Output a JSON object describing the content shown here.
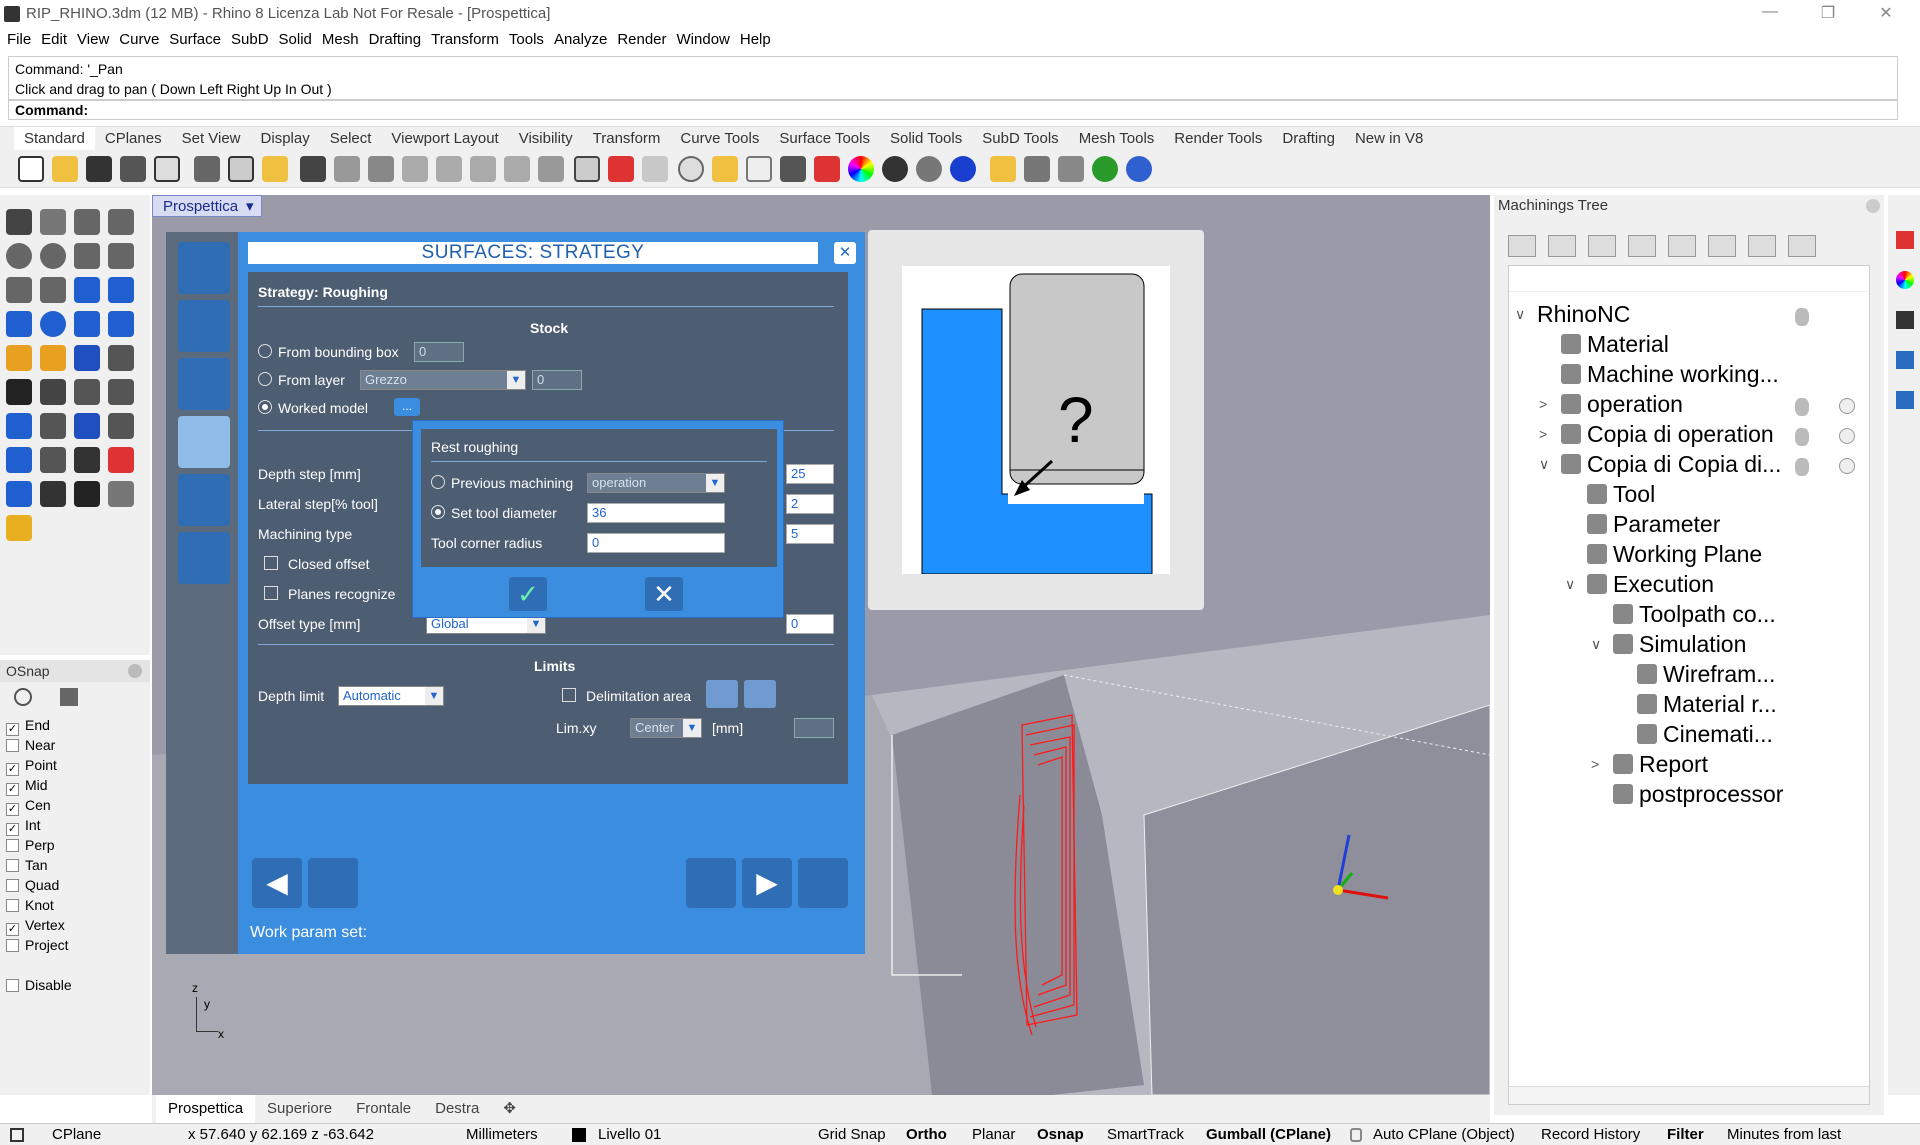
{
  "window": {
    "title": "RIP_RHINO.3dm (12 MB) - Rhino 8 Licenza Lab Not For Resale - [Prospettica]",
    "min": "—",
    "restore": "❐",
    "close": "✕"
  },
  "menu": [
    "File",
    "Edit",
    "View",
    "Curve",
    "Surface",
    "SubD",
    "Solid",
    "Mesh",
    "Drafting",
    "Transform",
    "Tools",
    "Analyze",
    "Render",
    "Window",
    "Help"
  ],
  "command": {
    "history1": "Command: '_Pan",
    "history2": "Click and drag to pan ( Down  Left  Right  Up  In  Out )",
    "prompt": "Command:"
  },
  "toolbar_tabs": [
    "Standard",
    "CPlanes",
    "Set View",
    "Display",
    "Select",
    "Viewport Layout",
    "Visibility",
    "Transform",
    "Curve Tools",
    "Surface Tools",
    "Solid Tools",
    "SubD Tools",
    "Mesh Tools",
    "Render Tools",
    "Drafting",
    "New in V8"
  ],
  "osnap": {
    "title": "OSnap",
    "items": [
      {
        "label": "End",
        "checked": true
      },
      {
        "label": "Near",
        "checked": false
      },
      {
        "label": "Point",
        "checked": true
      },
      {
        "label": "Mid",
        "checked": true
      },
      {
        "label": "Cen",
        "checked": true
      },
      {
        "label": "Int",
        "checked": true
      },
      {
        "label": "Perp",
        "checked": false
      },
      {
        "label": "Tan",
        "checked": false
      },
      {
        "label": "Quad",
        "checked": false
      },
      {
        "label": "Knot",
        "checked": false
      },
      {
        "label": "Vertex",
        "checked": true
      },
      {
        "label": "Project",
        "checked": false
      }
    ],
    "disable": "Disable",
    "check_mark": "✓"
  },
  "viewport": {
    "label": "Prospettica",
    "tabs": [
      "Prospettica",
      "Superiore",
      "Frontale",
      "Destra"
    ],
    "add": "✥",
    "axis_z": "z",
    "axis_y": "y",
    "axis_x": "x"
  },
  "dialog": {
    "title": "SURFACES:  STRATEGY",
    "close": "✕",
    "strategy": "Strategy: Roughing",
    "stock_header": "Stock",
    "from_bbox": "From bounding box",
    "from_bbox_val": "0",
    "from_layer": "From layer",
    "layer_val": "Grezzo",
    "layer_num": "0",
    "worked_model": "Worked model",
    "worked_btn": "...",
    "depth_step": "Depth step [mm]",
    "depth_step_val": "25",
    "lateral_step": "Lateral step[% tool]",
    "lateral_step_val": "2",
    "machining_type": "Machining type",
    "machining_type_val": "5",
    "closed_offset": "Closed offset",
    "planes_recognize": "Planes recognize",
    "offset_type": "Offset type [mm]",
    "offset_type_val": "Global",
    "offset_val": "0",
    "limits_header": "Limits",
    "depth_limit": "Depth limit",
    "depth_limit_val": "Automatic",
    "delim_area": "Delimitation area",
    "limxy": "Lim.xy",
    "limxy_val": "Center",
    "mm": "[mm]",
    "work_param": "Work param set:",
    "rest": {
      "title": "Rest roughing",
      "prev": "Previous machining",
      "prev_val": "operation",
      "set_diam": "Set tool diameter",
      "diam_val": "36",
      "corner": "Tool corner radius",
      "corner_val": "0",
      "ok": "✓",
      "cancel": "✕"
    },
    "nav": {
      "back": "◀",
      "fwd": "▶"
    }
  },
  "preview": {
    "question": "?"
  },
  "tree": {
    "title": "Machinings Tree",
    "nodes": [
      {
        "label": "RhinoNC",
        "exp": "∨"
      },
      {
        "label": "Material",
        "exp": ""
      },
      {
        "label": "Machine working...",
        "exp": ""
      },
      {
        "label": "operation",
        "exp": ">"
      },
      {
        "label": "Copia di operation",
        "exp": ">"
      },
      {
        "label": "Copia di Copia di...",
        "exp": "∨"
      },
      {
        "label": "Tool",
        "exp": ""
      },
      {
        "label": "Parameter",
        "exp": ""
      },
      {
        "label": "Working Plane",
        "exp": ""
      },
      {
        "label": "Execution",
        "exp": "∨"
      },
      {
        "label": "Toolpath co...",
        "exp": ""
      },
      {
        "label": "Simulation",
        "exp": "∨"
      },
      {
        "label": "Wirefram...",
        "exp": ""
      },
      {
        "label": "Material r...",
        "exp": ""
      },
      {
        "label": "Cinemati...",
        "exp": ""
      },
      {
        "label": "Report",
        "exp": ">"
      },
      {
        "label": "postprocessor",
        "exp": ""
      }
    ]
  },
  "status": {
    "cplane": "CPlane",
    "coords": "x 57.640  y 62.169  z -63.642",
    "units": "Millimeters",
    "layer": "Livello 01",
    "grid": "Grid Snap",
    "ortho": "Ortho",
    "planar": "Planar",
    "osnap": "Osnap",
    "smart": "SmartTrack",
    "gumball": "Gumball (CPlane)",
    "autocp": "Auto CPlane (Object)",
    "history": "Record History",
    "filter": "Filter",
    "minutes": "Minutes from last"
  },
  "colors": {
    "dialog_blue": "#3b8de0",
    "panel": "#4d5d72",
    "stock": "#1e90ff",
    "toolpath": "#ff0000"
  }
}
